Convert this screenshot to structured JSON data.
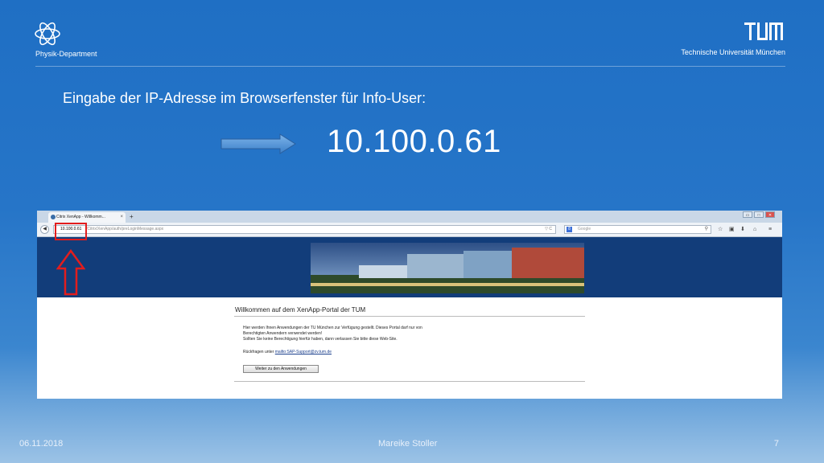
{
  "header": {
    "department": "Physik-Department",
    "university": "Technische Universität München"
  },
  "slide": {
    "heading": "Eingabe der IP-Adresse im Browserfenster für Info-User:",
    "ip_address": "10.100.0.61"
  },
  "browser": {
    "tab_title": "Citrix XenApp - Willkomm...",
    "tab_close": "×",
    "new_tab": "+",
    "url_host": "10.100.0.61",
    "url_path": "/Citrix/XenApp/auth/preLoginMessage.aspx",
    "url_icons": "▽ C",
    "search_engine": "8",
    "search_placeholder": "Google",
    "window_controls": [
      "▭",
      "□",
      "✕"
    ]
  },
  "portal": {
    "welcome_title": "Willkommen auf dem XenApp-Portal der TUM",
    "paragraph_lines": [
      "Hier werden Ihnen Anwendungen der TU München zur Verfügung gestellt. Dieses Portal darf nur von",
      "Berechtigten Anwendern verwendet werden!",
      "Sollten Sie keine Berechtigung hierfür haben, dann verlassen Sie bitte diese Web-Site."
    ],
    "contact_prefix": "Rückfragen unter",
    "contact_link": "mailto:SAP-Support@zv.tum.de",
    "button_label": "Weiter zu den Anwendungen"
  },
  "footer": {
    "date": "06.11.2018",
    "author": "Mareike Stoller",
    "page": "7"
  },
  "colors": {
    "accent_red": "#e21d1d",
    "banner_blue": "#123d7a",
    "arrow_blue": "#4a8fd6"
  }
}
